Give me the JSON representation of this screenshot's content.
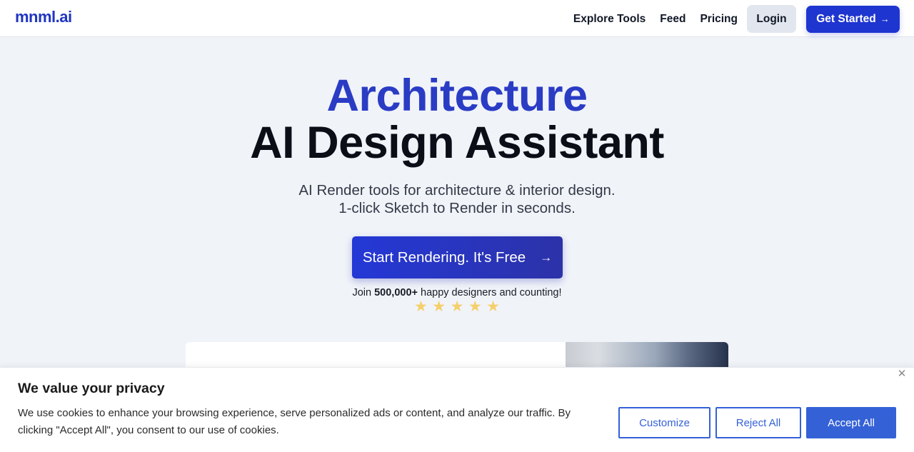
{
  "header": {
    "logo": "mnml.ai",
    "nav": [
      "Explore Tools",
      "Feed",
      "Pricing"
    ],
    "login_label": "Login",
    "get_started_label": "Get Started",
    "get_started_icon": "→"
  },
  "hero": {
    "title_line1": "Architecture",
    "title_line2": "AI Design Assistant",
    "subtitle_line1": "AI Render tools for architecture & interior design.",
    "subtitle_line2": "1-click Sketch to Render in seconds.",
    "cta_label": "Start Rendering. It's Free",
    "cta_icon": "→",
    "social_prefix": "Join ",
    "social_count": "500,000+",
    "social_suffix": " happy designers and counting!",
    "rating_stars": 5,
    "star_glyph": "★"
  },
  "cookie_banner": {
    "title": "We value your privacy",
    "text": "We use cookies to enhance your browsing experience, serve personalized ads or content, and analyze our traffic. By clicking \"Accept All\", you consent to our use of cookies.",
    "close_icon": "✕",
    "customize_label": "Customize",
    "reject_label": "Reject All",
    "accept_label": "Accept All"
  },
  "colors": {
    "brand": "#1f35d0",
    "title_accent": "#2a3cc4",
    "cookie_accent": "#3461d6",
    "star": "#f5cf6a"
  }
}
